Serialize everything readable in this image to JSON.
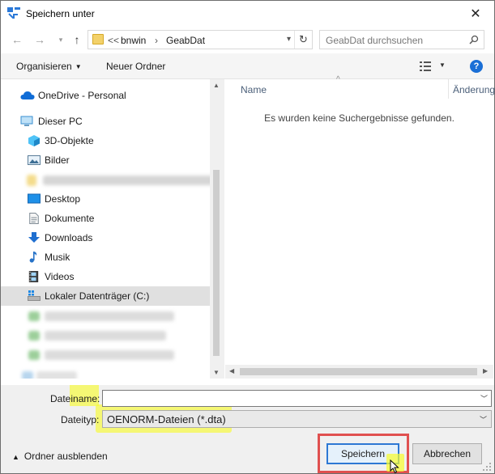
{
  "title": "Speichern unter",
  "address": {
    "prefix": "<<",
    "segments": [
      "bnwin",
      "GeabDat"
    ],
    "separator": "›"
  },
  "search": {
    "placeholder": "GeabDat durchsuchen"
  },
  "toolbar": {
    "organize_label": "Organisieren",
    "new_folder_label": "Neuer Ordner",
    "help_label": "?"
  },
  "sidebar": {
    "onedrive": "OneDrive - Personal",
    "this_pc": "Dieser PC",
    "items": [
      {
        "label": "3D-Objekte",
        "icon": "cube-3d-icon"
      },
      {
        "label": "Bilder",
        "icon": "pictures-icon"
      },
      {
        "label": "Desktop",
        "icon": "desktop-icon"
      },
      {
        "label": "Dokumente",
        "icon": "documents-icon"
      },
      {
        "label": "Downloads",
        "icon": "downloads-icon"
      },
      {
        "label": "Musik",
        "icon": "music-icon"
      },
      {
        "label": "Videos",
        "icon": "videos-icon"
      },
      {
        "label": "Lokaler Datenträger (C:)",
        "icon": "drive-icon"
      }
    ]
  },
  "list": {
    "columns": [
      "Name",
      "Änderung"
    ],
    "empty_message": "Es wurden keine Suchergebnisse gefunden."
  },
  "form": {
    "filename_label": "Dateiname:",
    "filename_value": "",
    "filetype_label": "Dateityp:",
    "filetype_value": "OENORM-Dateien (*.dta)"
  },
  "footer": {
    "hide_folders_label": "Ordner ausblenden",
    "save_label": "Speichern",
    "cancel_label": "Abbrechen"
  },
  "colors": {
    "accent": "#2d78d4",
    "highlight": "#f8fc28",
    "annotation_red": "#e0504f"
  }
}
